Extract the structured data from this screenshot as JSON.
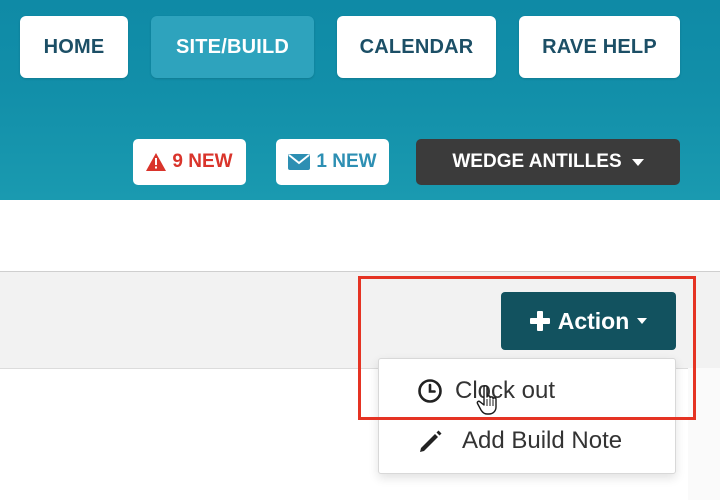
{
  "nav": {
    "items": [
      {
        "label": "HOME",
        "active": false
      },
      {
        "label": "SITE/BUILD",
        "active": true
      },
      {
        "label": "CALENDAR",
        "active": false
      },
      {
        "label": "RAVE HELP",
        "active": false
      }
    ]
  },
  "notifications": {
    "alerts_label": "9 NEW",
    "messages_label": "1 NEW"
  },
  "user_menu": {
    "name": "WEDGE ANTILLES"
  },
  "action": {
    "label": "Action",
    "menu": [
      {
        "label": "Clock out",
        "icon": "clock-icon"
      },
      {
        "label": "Add Build Note",
        "icon": "pencil-icon"
      }
    ]
  },
  "colors": {
    "header": "#128fa9",
    "active_nav": "#2ea3bd",
    "action_button": "#12525f",
    "user_button": "#3b3b3b",
    "alert": "#d9342b",
    "highlight": "#e53323"
  }
}
